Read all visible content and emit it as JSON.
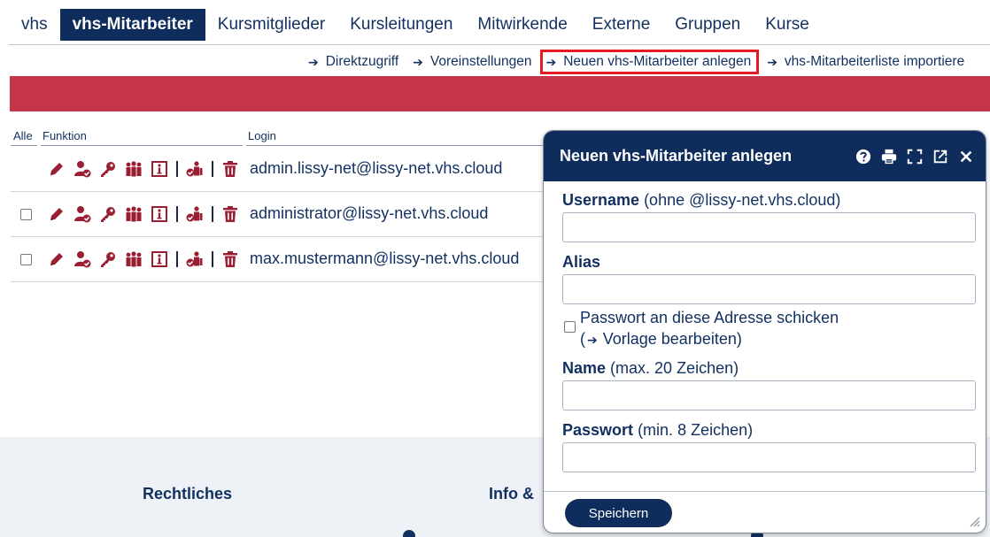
{
  "topnav": {
    "tabs": [
      {
        "label": "vhs",
        "active": false
      },
      {
        "label": "vhs-Mitarbeiter",
        "active": true
      },
      {
        "label": "Kursmitglieder",
        "active": false
      },
      {
        "label": "Kursleitungen",
        "active": false
      },
      {
        "label": "Mitwirkende",
        "active": false
      },
      {
        "label": "Externe",
        "active": false
      },
      {
        "label": "Gruppen",
        "active": false
      },
      {
        "label": "Kurse",
        "active": false
      }
    ]
  },
  "subnav": {
    "links": [
      {
        "label": "Direktzugriff"
      },
      {
        "label": "Voreinstellungen"
      },
      {
        "label": "Neuen vhs-Mitarbeiter anlegen",
        "highlighted": true
      },
      {
        "label": "vhs-Mitarbeiterliste importiere"
      }
    ]
  },
  "table": {
    "headers": {
      "all": "Alle",
      "function": "Funktion",
      "login": "Login"
    },
    "rows": [
      {
        "login": "admin.lissy-net@lissy-net.vhs.cloud",
        "checkbox": false
      },
      {
        "login": "administrator@lissy-net.vhs.cloud",
        "checkbox": true
      },
      {
        "login": "max.mustermann@lissy-net.vhs.cloud",
        "checkbox": true
      }
    ],
    "row_icons": [
      "edit-icon",
      "user-check-icon",
      "key-icon",
      "group-icon",
      "info-icon",
      "assign-user-icon",
      "delete-icon"
    ]
  },
  "footer": {
    "col1_heading": "Rechtliches",
    "col2_heading": "Info &"
  },
  "dialog": {
    "title": "Neuen vhs-Mitarbeiter anlegen",
    "tools": [
      "help-icon",
      "print-icon",
      "fullscreen-icon",
      "popout-icon",
      "close-icon"
    ],
    "fields": {
      "username": {
        "label": "Username",
        "hint": "(ohne @lissy-net.vhs.cloud)",
        "value": ""
      },
      "alias": {
        "label": "Alias",
        "value": ""
      },
      "send_password": {
        "label": "Passwort an diese Adresse schicken",
        "link_prefix": "(",
        "link": "Vorlage bearbeiten",
        "link_suffix": ")",
        "checked": false
      },
      "name": {
        "label": "Name",
        "hint": "(max. 20 Zeichen)",
        "value": ""
      },
      "password": {
        "label": "Passwort",
        "hint": "(min. 8 Zeichen)",
        "value": ""
      }
    },
    "save_label": "Speichern"
  },
  "colors": {
    "navy": "#0e2d5c",
    "banner": "#c5364a",
    "icon_red": "#9a1f33",
    "highlight": "#e31b23",
    "footer_bg": "#eef1f5"
  }
}
